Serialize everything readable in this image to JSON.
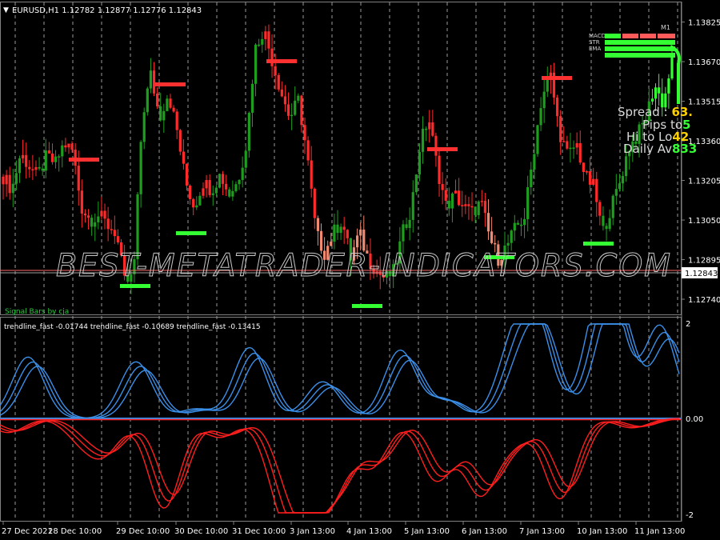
{
  "main_chart": {
    "header": "EURUSD,H1  1.12782 1.12877 1.12776 1.12843",
    "current_price_label": "1.12843",
    "indicator_label": "Signal Bars by cja",
    "watermark": "BEST-METATRADER-INDICATORS.COM",
    "price_axis": [
      "1.13825",
      "1.13670",
      "1.13515",
      "1.13360",
      "1.13205",
      "1.13050",
      "1.12895",
      "1.12740"
    ],
    "timeframe_tag": "M1",
    "signal_rows": [
      "MACD",
      "STR",
      "EMA"
    ],
    "info_panel": {
      "spread_label": "Spread :",
      "spread_value": "63.",
      "pips_label": "Pips to",
      "pips_value": "5",
      "hilo_label": "Hi to Lo",
      "hilo_value": "42",
      "daily_label": "Daily Av",
      "daily_value": "833"
    },
    "colors": {
      "bull": "#1e9e1e",
      "bull_bright": "#33ff33",
      "bear": "#ff2a2a",
      "salmon": "#f08a70"
    }
  },
  "sub_window": {
    "header": "trendline_fast -0.01744  trendline_fast -0.10689  trendline_fast -0.13415",
    "axis": [
      "2",
      "0.00",
      "-2"
    ],
    "colors": {
      "positive": "#3b8fe8",
      "negative": "#ff1e1e"
    }
  },
  "time_axis": [
    "27 Dec 2021",
    "28 Dec 10:00",
    "29 Dec 10:00",
    "30 Dec 10:00",
    "31 Dec 10:00",
    "3 Jan 13:00",
    "4 Jan 13:00",
    "5 Jan 13:00",
    "6 Jan 13:00",
    "7 Jan 13:00",
    "10 Jan 13:00",
    "11 Jan 13:00"
  ],
  "chart_data": {
    "type": "candlestick",
    "symbol": "EURUSD",
    "timeframe": "H1",
    "ylim": [
      1.1269,
      1.1388
    ],
    "x": [
      "27 Dec 2021",
      "28 Dec 10:00",
      "29 Dec 10:00",
      "30 Dec 10:00",
      "31 Dec 10:00",
      "3 Jan 13:00",
      "4 Jan 13:00",
      "5 Jan 13:00",
      "6 Jan 13:00",
      "7 Jan 13:00",
      "10 Jan 13:00",
      "11 Jan 13:00"
    ],
    "close_path": [
      1.1322,
      1.1317,
      1.1331,
      1.1326,
      1.1322,
      1.133,
      1.1327,
      1.1335,
      1.1332,
      1.131,
      1.1305,
      1.1307,
      1.1303,
      1.13,
      1.128,
      1.1283,
      1.1345,
      1.1362,
      1.1345,
      1.1355,
      1.134,
      1.132,
      1.131,
      1.132,
      1.1317,
      1.1323,
      1.1315,
      1.132,
      1.1335,
      1.1372,
      1.138,
      1.1367,
      1.1355,
      1.1345,
      1.1352,
      1.133,
      1.13,
      1.1292,
      1.13,
      1.1305,
      1.129,
      1.13,
      1.129,
      1.1285,
      1.1282,
      1.1285,
      1.13,
      1.131,
      1.1335,
      1.1345,
      1.1325,
      1.131,
      1.1315,
      1.131,
      1.1308,
      1.1312,
      1.1298,
      1.129,
      1.1295,
      1.1302,
      1.1306,
      1.133,
      1.1353,
      1.1362,
      1.134,
      1.133,
      1.1335,
      1.1322,
      1.1318,
      1.13,
      1.131,
      1.132,
      1.1333,
      1.1338,
      1.1345,
      1.1358,
      1.135,
      1.1368
    ]
  }
}
